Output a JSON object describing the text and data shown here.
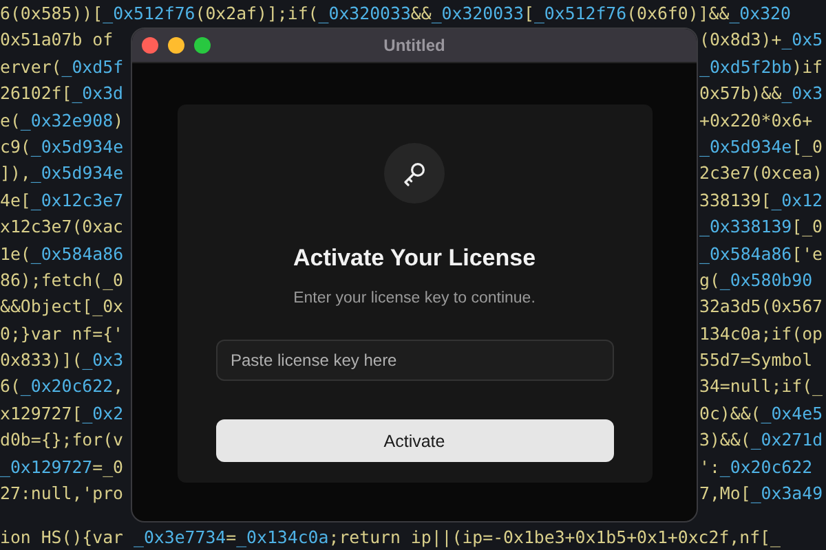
{
  "code_background": {
    "top_line": "6(0x585))[_0x512f76(0x2af)];if(_0x320033&&_0x320033[_0x512f76(0x6f0)]&&_0x320",
    "lines": [
      {
        "left": "0x51a07b of",
        "right": "(0x8d3)+_0x5"
      },
      {
        "left": "erver(_0xd5f",
        "right": "_0xd5f2bb)if"
      },
      {
        "left": "26102f[_0x3d",
        "right": "0x57b)&&_0x3"
      },
      {
        "left": "e(_0x32e908)",
        "right": "+0x220*0x6+"
      },
      {
        "left": "c9(_0x5d934e",
        "right": "_0x5d934e[_0"
      },
      {
        "left": "]),_0x5d934e",
        "right": "2c3e7(0xcea)"
      },
      {
        "left": "4e[_0x12c3e7",
        "right": "338139[_0x12"
      },
      {
        "left": "x12c3e7(0xac",
        "right": "_0x338139[_0"
      },
      {
        "left": "1e(_0x584a86",
        "right": "_0x584a86['e"
      },
      {
        "left": "86);fetch(_0",
        "right": "g(_0x580b90"
      },
      {
        "left": "&&Object[_0x",
        "right": "32a3d5(0x567"
      },
      {
        "left": "0;}var nf={'",
        "right": "134c0a;if(op"
      },
      {
        "left": "0x833)](_0x3",
        "right": "55d7=Symbol"
      },
      {
        "left": "6(_0x20c622,",
        "right": "34=null;if(_"
      },
      {
        "left": "x129727[_0x2",
        "right": "0c)&&(_0x4e5"
      },
      {
        "left": "d0b={};for(v",
        "right": "3)&&(_0x271d"
      },
      {
        "left": "_0x129727=_0",
        "right": "':_0x20c622"
      },
      {
        "left": "27:null,'pro",
        "right": "7,Mo[_0x3a49"
      }
    ],
    "bottom_line": "ion HS(){var _0x3e7734=_0x134c0a;return ip||(ip=-0x1be3+0x1b5+0x1+0xc2f,nf[_"
  },
  "window": {
    "title": "Untitled"
  },
  "dialog": {
    "title": "Activate Your License",
    "subtitle": "Enter your license key to continue.",
    "license_field": {
      "placeholder": "Paste license key here"
    },
    "button": "Activate"
  }
}
